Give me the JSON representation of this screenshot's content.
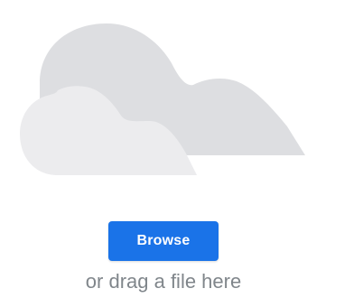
{
  "upload": {
    "illustration": "cloud-icon",
    "browse_label": "Browse",
    "drag_hint": "or drag a file here"
  },
  "colors": {
    "accent": "#1a73e8",
    "cloud_back": "#dadce0",
    "cloud_front": "#ebebeb",
    "hint_text": "#80868b"
  }
}
